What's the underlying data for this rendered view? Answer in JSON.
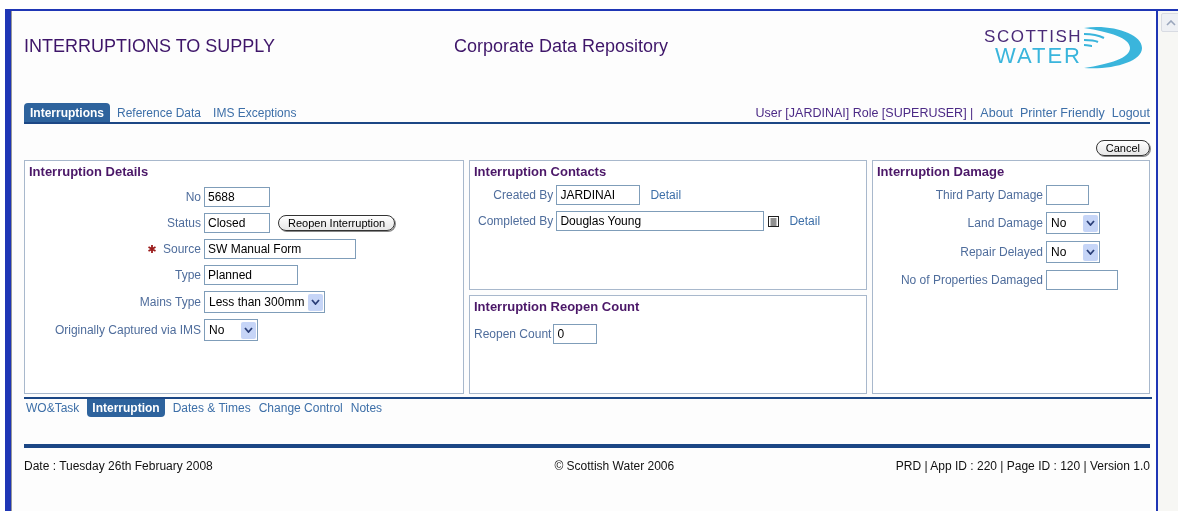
{
  "header": {
    "title": "INTERRUPTIONS TO SUPPLY",
    "subtitle": "Corporate Data Repository",
    "logo": {
      "line1": "SCOTTISH",
      "line2": "WATER"
    }
  },
  "nav_tabs": [
    {
      "label": "Interruptions",
      "selected": true
    },
    {
      "label": "Reference Data",
      "selected": false
    },
    {
      "label": "IMS Exceptions",
      "selected": false
    }
  ],
  "user_info": "User [JARDINAI] Role [SUPERUSER] |",
  "top_links": [
    "About",
    "Printer Friendly",
    "Logout"
  ],
  "cancel_button": "Cancel",
  "details": {
    "title": "Interruption Details",
    "fields": [
      {
        "label": "No",
        "kind": "text",
        "value": "5688",
        "required": false
      },
      {
        "label": "Status",
        "kind": "text",
        "value": "Closed",
        "required": false,
        "button": "Reopen Interruption"
      },
      {
        "label": "Source",
        "kind": "text",
        "value": "SW Manual Form",
        "required": true
      },
      {
        "label": "Type",
        "kind": "text",
        "value": "Planned",
        "required": false
      },
      {
        "label": "Mains Type",
        "kind": "select",
        "value": "Less than 300mm",
        "required": false
      },
      {
        "label": "Originally Captured via IMS",
        "kind": "select",
        "value": "No",
        "required": false
      }
    ]
  },
  "contacts": {
    "title": "Interruption Contacts",
    "fields": [
      {
        "label": "Created By",
        "value": "JARDINAI",
        "lookup": false,
        "link": "Detail"
      },
      {
        "label": "Completed By",
        "value": "Douglas Young",
        "lookup": true,
        "link": "Detail"
      }
    ]
  },
  "reopen": {
    "title": "Interruption Reopen Count",
    "fields": [
      {
        "label": "Reopen Count",
        "value": "0"
      }
    ]
  },
  "damage": {
    "title": "Interruption Damage",
    "fields": [
      {
        "label": "Third Party Damage",
        "kind": "text"
      },
      {
        "label": "Land Damage",
        "kind": "select",
        "value": "No"
      },
      {
        "label": "Repair Delayed",
        "kind": "select",
        "value": "No"
      },
      {
        "label": "No of Properties Damaged",
        "kind": "text"
      }
    ]
  },
  "sub_tabs": [
    {
      "label": "WO&Task",
      "selected": false
    },
    {
      "label": "Interruption",
      "selected": true
    },
    {
      "label": "Dates & Times",
      "selected": false
    },
    {
      "label": "Change Control",
      "selected": false
    },
    {
      "label": "Notes",
      "selected": false
    }
  ],
  "footer": {
    "date": "Date : Tuesday 26th February 2008",
    "copyright": "© Scottish Water 2006",
    "info": "PRD | App ID : 220 | Page ID : 120 | Version 1.0"
  }
}
